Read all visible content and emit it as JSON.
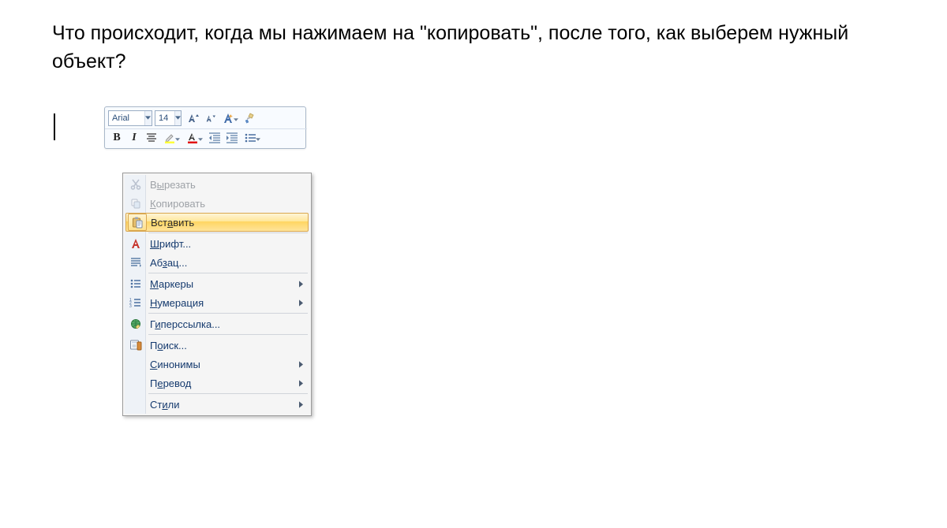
{
  "question": "Что происходит, когда мы нажимаем на \"копировать\", после того, как выберем нужный объект?",
  "toolbar": {
    "font_name": "Arial",
    "font_size": "14"
  },
  "context_menu": {
    "cut": {
      "label_pre": "В",
      "label_u": "ы",
      "label_post": "резать"
    },
    "copy": {
      "label_pre": "",
      "label_u": "К",
      "label_post": "опировать"
    },
    "paste": {
      "label_pre": "Вст",
      "label_u": "а",
      "label_post": "вить"
    },
    "font": {
      "label_pre": "",
      "label_u": "Ш",
      "label_post": "рифт..."
    },
    "paragraph": {
      "label_pre": "Аб",
      "label_u": "з",
      "label_post": "ац..."
    },
    "bullets": {
      "label_pre": "",
      "label_u": "М",
      "label_post": "аркеры"
    },
    "numbering": {
      "label_pre": "",
      "label_u": "Н",
      "label_post": "умерация"
    },
    "hyperlink": {
      "label_pre": "Г",
      "label_u": "и",
      "label_post": "перссылка..."
    },
    "search": {
      "label_pre": "П",
      "label_u": "о",
      "label_post": "иск..."
    },
    "synonyms": {
      "label_pre": "",
      "label_u": "С",
      "label_post": "инонимы"
    },
    "translate": {
      "label_pre": "П",
      "label_u": "е",
      "label_post": "ревод"
    },
    "styles": {
      "label_pre": "Ст",
      "label_u": "и",
      "label_post": "ли"
    }
  }
}
